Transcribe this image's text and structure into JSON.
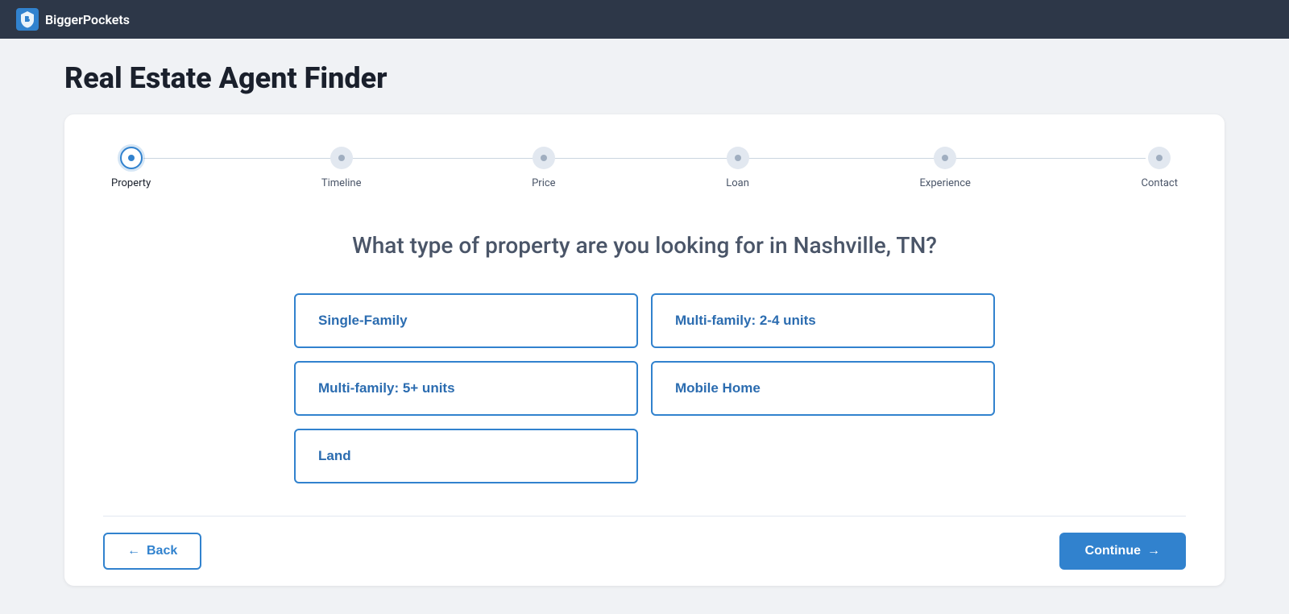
{
  "nav": {
    "logo_text": "BiggerPockets"
  },
  "page": {
    "title": "Real Estate Agent Finder"
  },
  "stepper": {
    "steps": [
      {
        "label": "Property",
        "active": true
      },
      {
        "label": "Timeline",
        "active": false
      },
      {
        "label": "Price",
        "active": false
      },
      {
        "label": "Loan",
        "active": false
      },
      {
        "label": "Experience",
        "active": false
      },
      {
        "label": "Contact",
        "active": false
      }
    ]
  },
  "question": {
    "text": "What type of property are you looking for in Nashville, TN?"
  },
  "options": [
    {
      "id": "single-family",
      "label": "Single-Family",
      "col_span": 1
    },
    {
      "id": "multi-2-4",
      "label": "Multi-family: 2-4 units",
      "col_span": 1
    },
    {
      "id": "multi-5-plus",
      "label": "Multi-family: 5+ units",
      "col_span": 1
    },
    {
      "id": "mobile-home",
      "label": "Mobile Home",
      "col_span": 1
    },
    {
      "id": "land",
      "label": "Land",
      "col_span": 1
    }
  ],
  "footer": {
    "back_label": "Back",
    "continue_label": "Continue"
  }
}
